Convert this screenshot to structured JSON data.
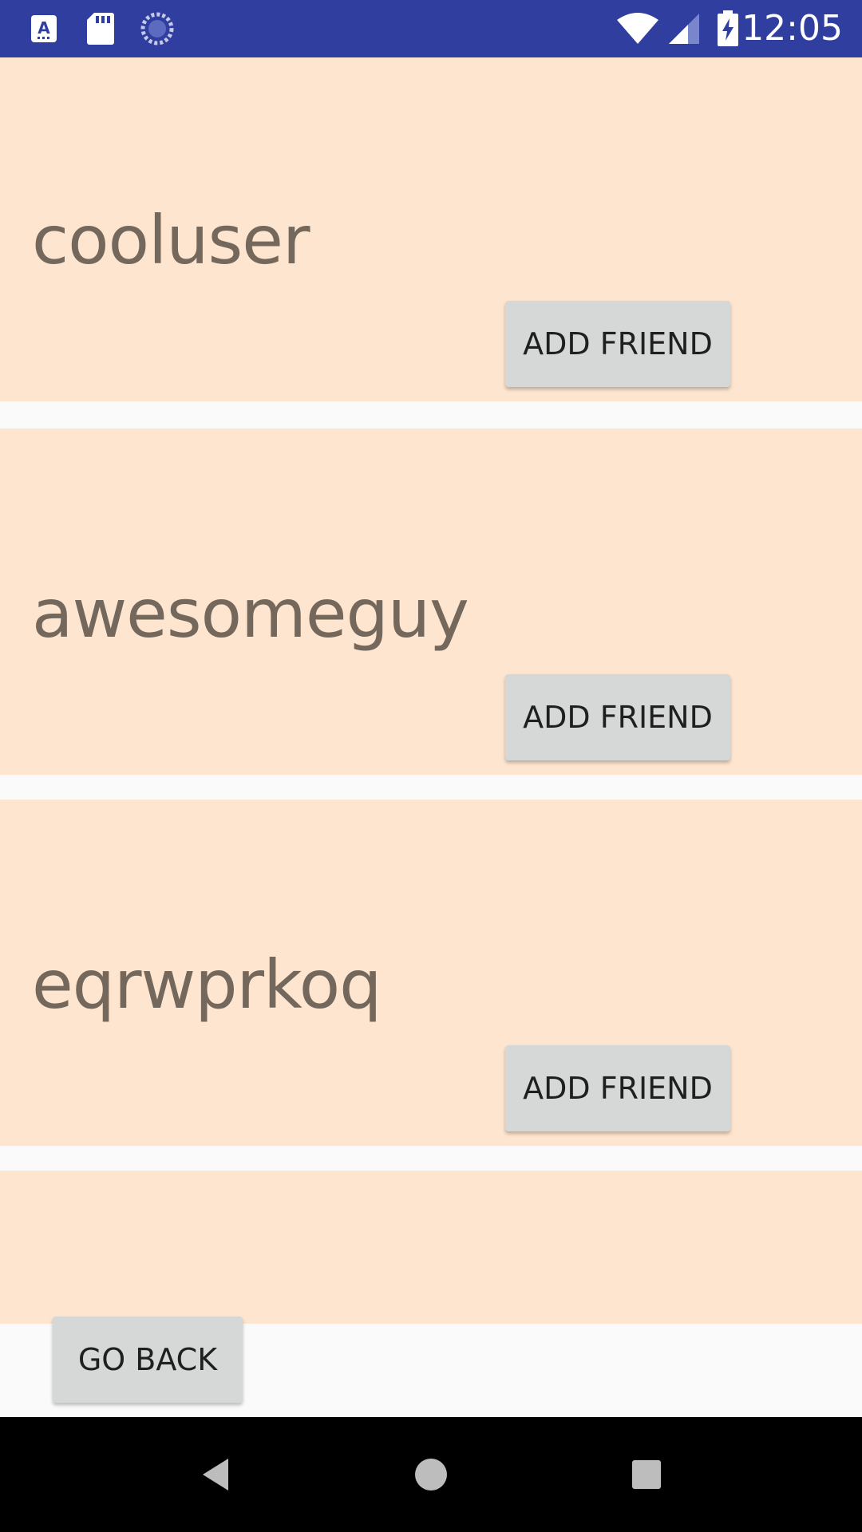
{
  "status_bar": {
    "time": "12:05",
    "icons": [
      "text-input-icon",
      "sd-card-icon",
      "sync-icon",
      "wifi-icon",
      "cell-signal-icon",
      "battery-charging-icon"
    ],
    "background": "#303f9f"
  },
  "users": [
    {
      "name": "cooluser",
      "button_label": "ADD FRIEND"
    },
    {
      "name": "awesomeguy",
      "button_label": "ADD FRIEND"
    },
    {
      "name": "eqrwprkoq",
      "button_label": "ADD FRIEND"
    }
  ],
  "footer": {
    "go_back_label": "GO BACK"
  },
  "nav_bar": {
    "icons": [
      "back-icon",
      "home-icon",
      "recents-icon"
    ]
  },
  "colors": {
    "card_background": "#fde5cf",
    "name_text": "#74675b",
    "button_background": "#d6d7d7"
  }
}
